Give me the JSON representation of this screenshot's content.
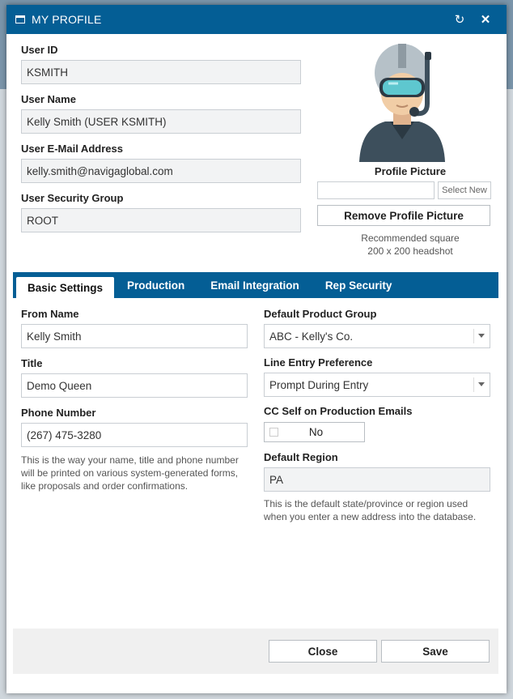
{
  "window": {
    "title": "MY PROFILE",
    "refresh_icon": "refresh-icon",
    "close_icon": "close-icon"
  },
  "profile": {
    "user_id": {
      "label": "User ID",
      "value": "KSMITH"
    },
    "user_name": {
      "label": "User Name",
      "value": "Kelly Smith (USER KSMITH)"
    },
    "email": {
      "label": "User E-Mail Address",
      "value": "kelly.smith@navigaglobal.com"
    },
    "security_group": {
      "label": "User Security Group",
      "value": "ROOT"
    },
    "picture": {
      "label": "Profile Picture",
      "select_new": "Select New",
      "remove": "Remove Profile Picture",
      "hint_line1": "Recommended square",
      "hint_line2": "200 x 200 headshot"
    }
  },
  "tabs": [
    {
      "label": "Basic Settings",
      "active": true
    },
    {
      "label": "Production",
      "active": false
    },
    {
      "label": "Email Integration",
      "active": false
    },
    {
      "label": "Rep Security",
      "active": false
    }
  ],
  "basic": {
    "from_name": {
      "label": "From Name",
      "value": "Kelly Smith"
    },
    "title": {
      "label": "Title",
      "value": "Demo Queen"
    },
    "phone": {
      "label": "Phone Number",
      "value": "(267) 475-3280"
    },
    "left_help": "This is the way your name, title and phone number will be printed on various system-generated forms, like proposals and order confirmations.",
    "product_group": {
      "label": "Default Product Group",
      "value": "ABC - Kelly's Co."
    },
    "line_entry": {
      "label": "Line Entry Preference",
      "value": "Prompt During Entry"
    },
    "cc_self": {
      "label": "CC Self on Production Emails",
      "value": "No"
    },
    "region": {
      "label": "Default Region",
      "value": "PA"
    },
    "right_help": "This is the default state/province or region used when you enter a new address into the database."
  },
  "footer": {
    "close": "Close",
    "save": "Save"
  },
  "colors": {
    "header": "#045e95",
    "field_readonly": "#f2f3f4",
    "footer": "#f0f0f0"
  }
}
